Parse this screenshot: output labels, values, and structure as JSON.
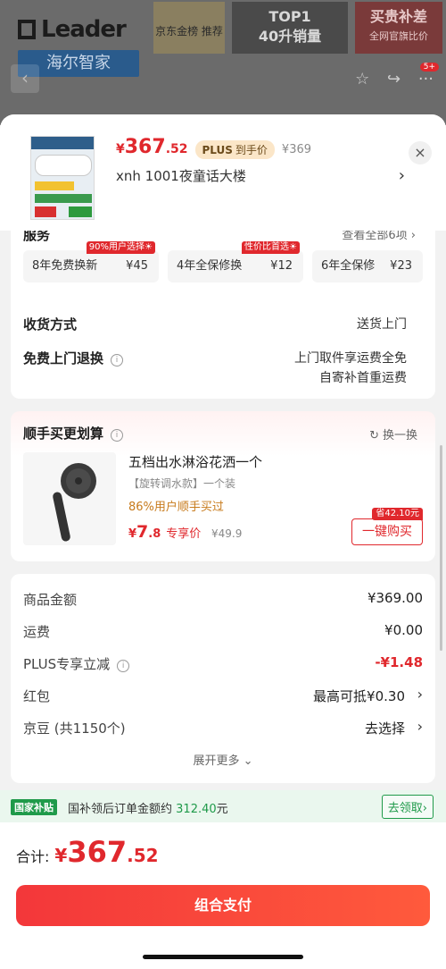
{
  "background_page": {
    "logo_text": "Leader",
    "brand_label": "海尔智家",
    "badge_rank": "京东金榜\n推荐",
    "badge_top_line1": "TOP1",
    "badge_top_line2": "40升销量",
    "badge_subsidy_line1": "买贵补差",
    "badge_subsidy_line2": "全网官旗比价",
    "cart_count": "5+"
  },
  "header": {
    "price_yen": "¥",
    "price_int": "367",
    "price_dec": ".52",
    "plus_label": "PLUS",
    "plus_suffix": "到手价",
    "original_price": "¥369",
    "address": "xnh  1001夜童话大楼"
  },
  "services": {
    "title": "服务",
    "view_all": "查看全部6项",
    "items": [
      {
        "name": "8年免费换新",
        "price": "¥45",
        "tag": "90%用户选择☀"
      },
      {
        "name": "4年全保修换",
        "price": "¥12",
        "tag": "性价比首选☀"
      },
      {
        "name": "6年全保修",
        "price": "¥23",
        "tag": ""
      }
    ],
    "delivery_label": "收货方式",
    "delivery_value": "送货上门",
    "return_label": "免费上门退换",
    "return_value_line1": "上门取件享运费全免",
    "return_value_line2": "自寄补首重运费"
  },
  "addon": {
    "title": "顺手买更划算",
    "swap_label": "换一换",
    "product_name": "五档出水淋浴花洒一个",
    "product_spec": "【旋转调水款】一个装",
    "hint": "86%用户顺手买过",
    "price_yen": "¥",
    "price_int": "7",
    "price_dec": ".8",
    "price_label": "专享价",
    "original_price": "¥49.9",
    "save_tag": "省42.10元",
    "buy_button": "一键购买"
  },
  "summary": {
    "rows": [
      {
        "label": "商品金额",
        "value": "¥369.00"
      },
      {
        "label": "运费",
        "value": "¥0.00"
      },
      {
        "label": "PLUS专享立减",
        "value": "-¥1.48"
      },
      {
        "label": "红包",
        "value": "最高可抵¥0.30"
      },
      {
        "label": "京豆 (共1150个)",
        "value": "去选择"
      }
    ],
    "expand_more": "展开更多"
  },
  "subsidy": {
    "badge": "国家补贴",
    "text_prefix": "国补领后订单金额约",
    "amount": "312.40",
    "text_suffix": "元",
    "button": "去领取"
  },
  "footer": {
    "total_label": "合计:",
    "total_yen": "¥",
    "total_int": "367",
    "total_dec": ".52",
    "pay_button": "组合支付"
  },
  "colors": {
    "accent_red": "#e0282d",
    "subsidy_green": "#1f9a4a",
    "plus_gold": "#fbe6c8"
  }
}
